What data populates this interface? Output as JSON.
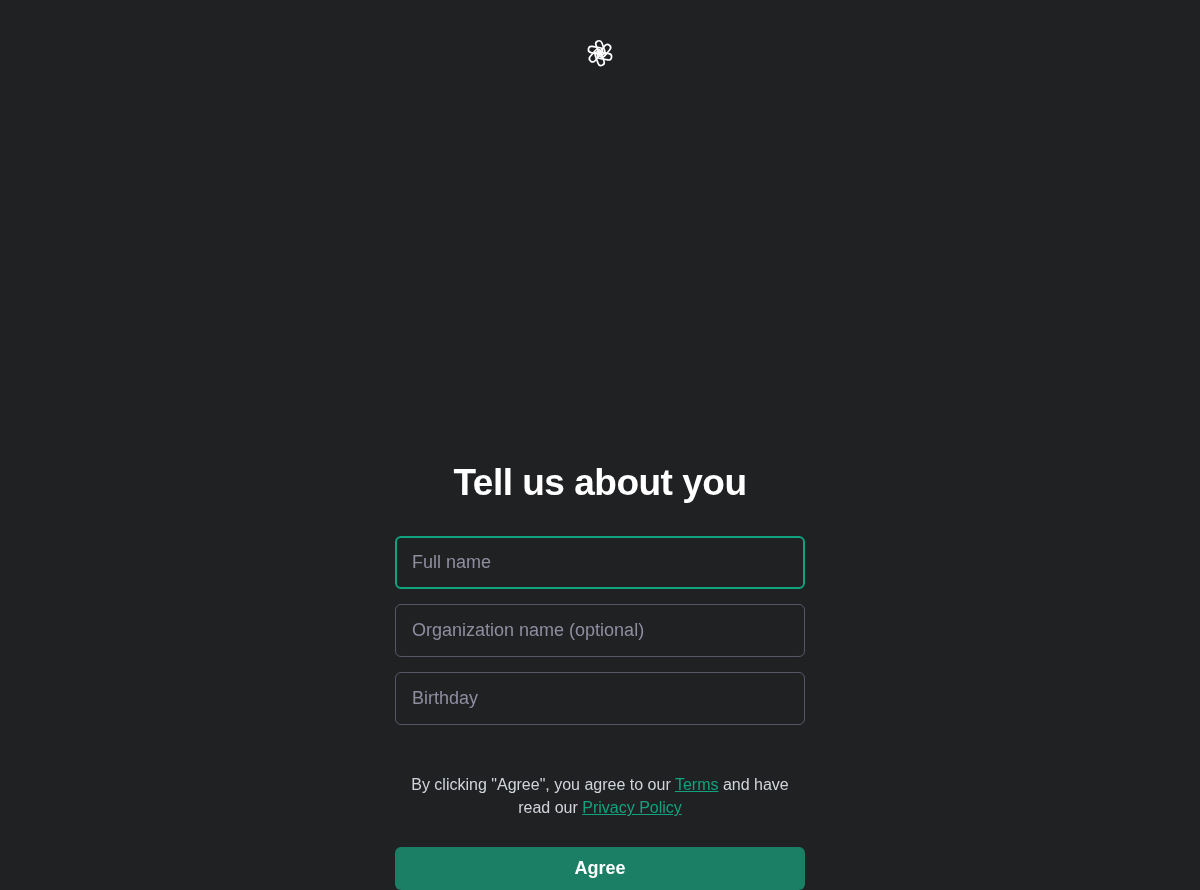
{
  "title": "Tell us about you",
  "fields": [
    {
      "placeholder": "Full name",
      "focused": true
    },
    {
      "placeholder": "Organization name (optional)",
      "focused": false
    },
    {
      "placeholder": "Birthday",
      "focused": false
    }
  ],
  "consent": [
    {
      "kind": "text",
      "text": "By clicking \"Agree\", you agree to our "
    },
    {
      "kind": "link",
      "text": "Terms"
    },
    {
      "kind": "text",
      "text": " and have read our "
    },
    {
      "kind": "link",
      "text": "Privacy Policy"
    }
  ],
  "button": "Agree"
}
